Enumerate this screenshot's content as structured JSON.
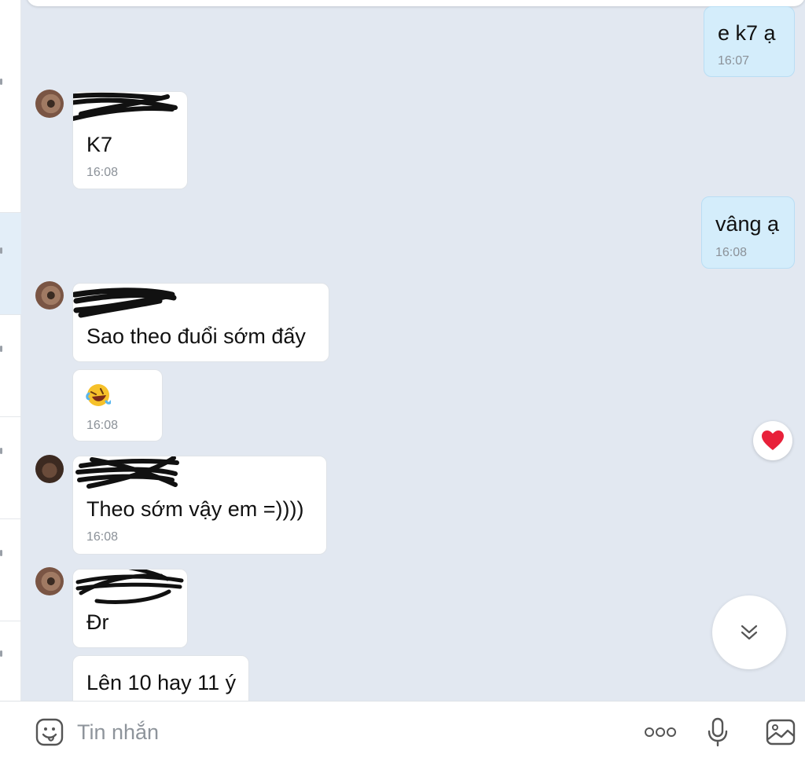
{
  "composer": {
    "placeholder": "Tin nhắn",
    "icons": [
      "emoji-icon",
      "more-icon",
      "microphone-icon",
      "image-icon"
    ]
  },
  "messages": [
    {
      "id": "m1",
      "direction": "outgoing",
      "text": "e k7 ạ",
      "time": "16:07"
    },
    {
      "id": "m2",
      "direction": "incoming",
      "sender_redacted": true,
      "text": "K7",
      "time": "16:08"
    },
    {
      "id": "m3",
      "direction": "outgoing",
      "text": "vâng ạ",
      "time": "16:08"
    },
    {
      "id": "m4",
      "direction": "incoming",
      "sender_redacted": true,
      "text": "Sao theo đuổi sớm đấy"
    },
    {
      "id": "m5",
      "direction": "incoming",
      "emoji": "rolling-on-floor-laughing",
      "time": "16:08"
    },
    {
      "id": "m6",
      "direction": "incoming",
      "sender_redacted": true,
      "text": "Theo sớm vậy em =))))",
      "time": "16:08"
    },
    {
      "id": "m7",
      "direction": "incoming",
      "sender_redacted": true,
      "text": "Đr"
    },
    {
      "id": "m8",
      "direction": "incoming",
      "text": "Lên 10 hay 11 ý"
    }
  ],
  "reaction": {
    "icon": "heart-icon",
    "color": "#e8213a"
  },
  "colors": {
    "chat_background": "#e2e8f1",
    "incoming_bubble": "#ffffff",
    "outgoing_bubble": "#d4edfb",
    "time_text": "#8b9198"
  }
}
